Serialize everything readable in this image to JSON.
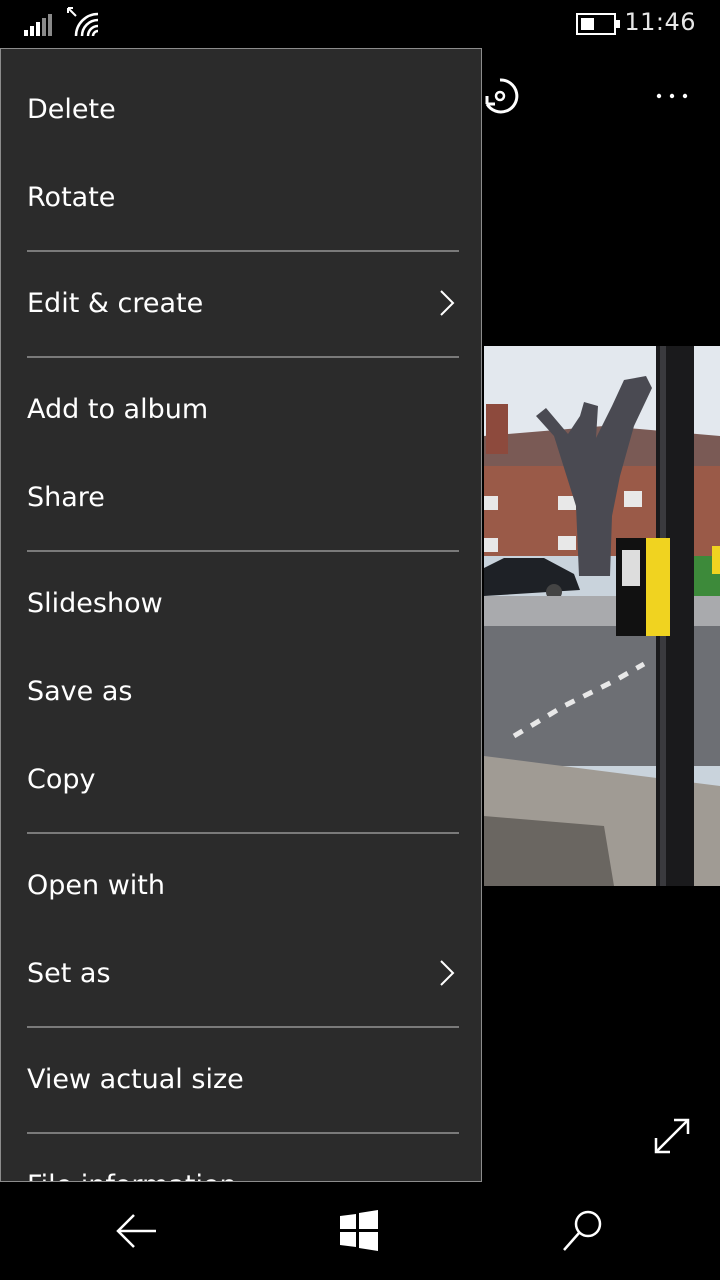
{
  "status_bar": {
    "time": "11:46"
  },
  "menu": {
    "delete": "Delete",
    "rotate": "Rotate",
    "edit_create": "Edit & create",
    "add_to_album": "Add to album",
    "share": "Share",
    "slideshow": "Slideshow",
    "save_as": "Save as",
    "copy": "Copy",
    "open_with": "Open with",
    "set_as": "Set as",
    "view_actual_size": "View actual size",
    "file_information": "File information"
  },
  "icons": {
    "signal": "signal-icon",
    "wifi": "wifi-icon",
    "battery": "battery-icon",
    "rotate": "rotate-icon",
    "more": "more-icon",
    "expand": "expand-icon",
    "back": "back-arrow-icon",
    "windows": "windows-icon",
    "search": "search-icon"
  },
  "colors": {
    "menu_bg": "#2b2b2b",
    "separator": "#7a7a7a",
    "background": "#000000"
  }
}
